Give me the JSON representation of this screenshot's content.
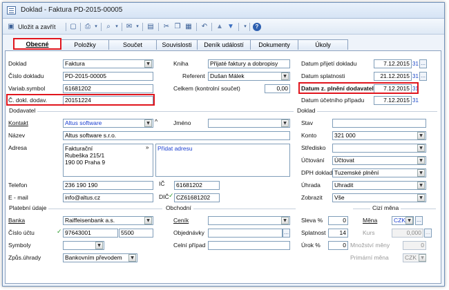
{
  "window": {
    "title": "Doklad - Faktura PD-2015-00005"
  },
  "toolbar": {
    "save_close": "Uložit a zavřít"
  },
  "tabs": [
    "Obecné",
    "Položky",
    "Součet",
    "Souvislosti",
    "Deník událostí",
    "Dokumenty",
    "Úkoly"
  ],
  "doc": {
    "doklad_label": "Doklad",
    "doklad_value": "Faktura",
    "cislo_label": "Číslo dokladu",
    "cislo_value": "PD-2015-00005",
    "varsym_label": "Variab.symbol",
    "varsym_value": "61681202",
    "cdodav_label": "Č. dokl. dodav.",
    "cdodav_value": "20151224",
    "kniha_label": "Kniha",
    "kniha_value": "Přijaté faktury a dobropisy",
    "referent_label": "Referent",
    "referent_value": "Dušan Málek",
    "celkem_label": "Celkem (kontrolní součet)",
    "celkem_value": "0,00",
    "dprij_label": "Datum přijetí dokladu",
    "dprij_value": "7.12.2015",
    "dspl_label": "Datum splatnosti",
    "dspl_value": "21.12.2015",
    "dplneni_label": "Datum z. plnění dodavatele",
    "dplneni_value": "7.12.2015",
    "ducet_label": "Datum účetního případu",
    "ducet_value": "7.12.2015",
    "cal_glyph": "31"
  },
  "dodavatel": {
    "section": "Dodavatel",
    "kontakt_label": "Kontakt",
    "kontakt_value": "Altus software",
    "jmeno_label": "Jméno",
    "jmeno_value": "",
    "nazev_label": "Název",
    "nazev_value": "Altus software s.r.o.",
    "adresa_label": "Adresa",
    "adresa_type": "Fakturační",
    "adresa_value": "Rubeška 215/1\n190 00 Praha 9",
    "pridat": "Přidat adresu",
    "telefon_label": "Telefon",
    "telefon_value": "236 190 190",
    "ic_label": "IČ",
    "ic_value": "61681202",
    "email_label": "E - mail",
    "email_value": "info@altus.cz",
    "dic_label": "DIČ",
    "dic_value": "CZ61681202"
  },
  "doklad2": {
    "section": "Doklad",
    "stav_label": "Stav",
    "stav_value": "",
    "konto_label": "Konto",
    "konto_value": "321 000",
    "stredisko_label": "Středisko",
    "stredisko_value": "",
    "uctovani_label": "Účtování",
    "uctovani_value": "Účtovat",
    "dph_label": "DPH doklad",
    "dph_value": "Tuzemské plnění",
    "uhrada_label": "Úhrada",
    "uhrada_value": "Uhradit",
    "zobrazit_label": "Zobrazit",
    "zobrazit_value": "Vše"
  },
  "platebni": {
    "section": "Platební údaje",
    "banka_label": "Banka",
    "banka_value": "Raiffeisenbank a.s.",
    "ucet_label": "Číslo účtu",
    "ucet_value": "97643001",
    "ucet_kod": "5500",
    "symboly_label": "Symboly",
    "symboly_value": "",
    "zpusob_label": "Způs.úhrady",
    "zpusob_value": "Bankovním převodem"
  },
  "obchodni": {
    "section": "Obchodní",
    "cenik_label": "Ceník",
    "cenik_value": "",
    "objednavky_label": "Objednávky",
    "objednavky_value": "",
    "celni_label": "Celní případ",
    "celni_value": ""
  },
  "sleva": {
    "sleva_label": "Sleva %",
    "sleva_value": "0",
    "splatnost_label": "Splatnost",
    "splatnost_value": "14",
    "urok_label": "Úrok %",
    "urok_value": "0"
  },
  "mena": {
    "section": "Cizí měna",
    "mena_label": "Měna",
    "mena_value": "CZK",
    "kurs_label": "Kurs",
    "kurs_value": "0,000",
    "mnozstvi_label": "Množství měny",
    "mnozstvi_value": "0",
    "primarni_label": "Primární měna",
    "primarni_value": "CZK"
  },
  "colors": {
    "highlight_red": "#e0141c",
    "link_blue": "#1a3fd0"
  }
}
